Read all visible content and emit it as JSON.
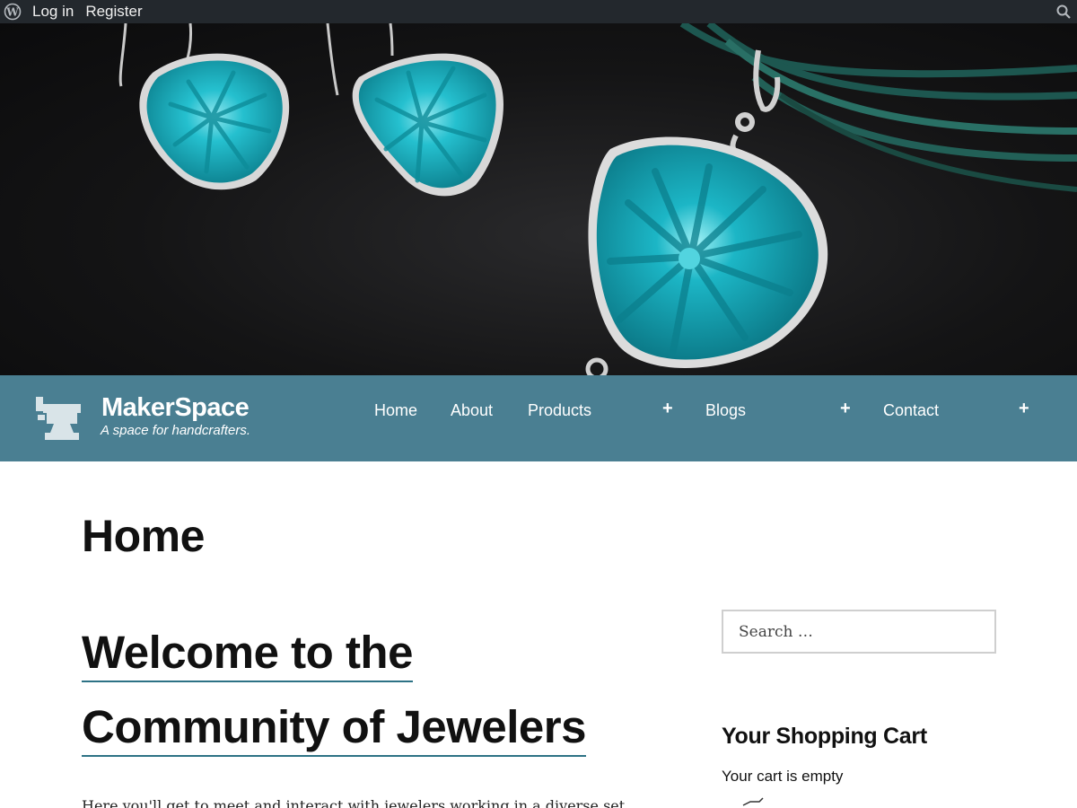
{
  "admin_bar": {
    "login_label": "Log in",
    "register_label": "Register",
    "logo_icon": "wordpress-icon",
    "search_icon": "search-icon"
  },
  "site": {
    "title": "MakerSpace",
    "tagline": "A space for handcrafters.",
    "logo_icon": "anvil-icon",
    "header_color": "#4a7f92"
  },
  "nav": {
    "items": [
      {
        "label": "Home"
      },
      {
        "label": "About"
      },
      {
        "label": "Products",
        "submenu_toggle": "+"
      },
      {
        "label": "Blogs",
        "submenu_toggle": "+"
      },
      {
        "label": "Contact",
        "submenu_toggle": "+"
      }
    ]
  },
  "main": {
    "page_title": "Home",
    "heading_line1": "Welcome to the",
    "heading_line2": "Community of Jewelers",
    "intro_text": "Here you'll get to meet and interact with jewelers working in a diverse set"
  },
  "sidebar": {
    "search_placeholder": "Search …",
    "cart_heading": "Your Shopping Cart",
    "cart_status": "Your cart is empty",
    "cart_icon": "cart-icon"
  },
  "colors": {
    "admin_bar": "#23282d",
    "accent_underline": "#2d7285",
    "gem_turquoise": "#16b3c2"
  }
}
